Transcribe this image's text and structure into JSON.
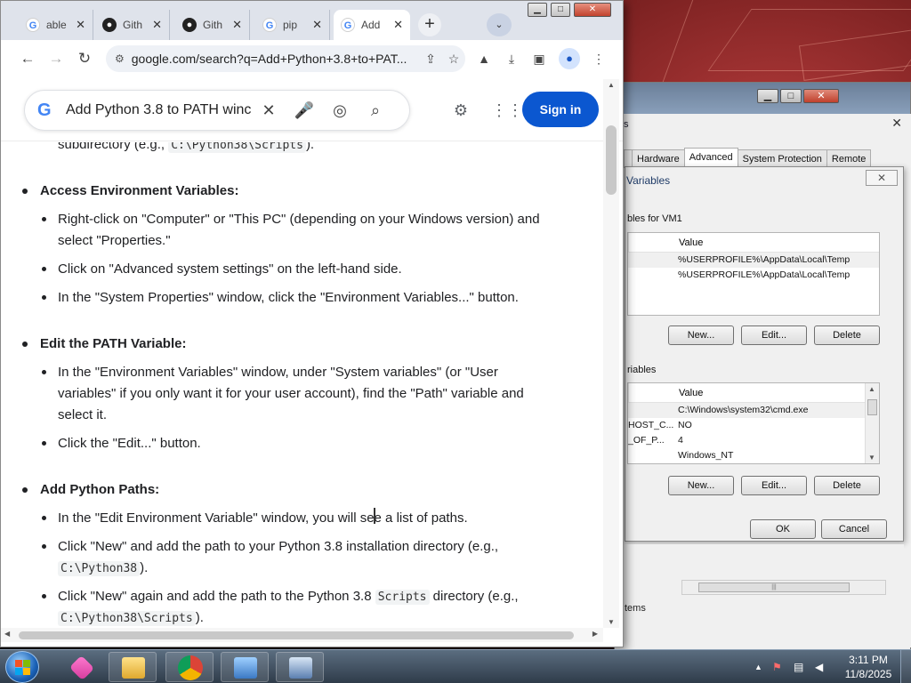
{
  "browser": {
    "tabs": [
      {
        "favicon": "google-g",
        "label": "able"
      },
      {
        "favicon": "github",
        "label": "Gith"
      },
      {
        "favicon": "github",
        "label": "Gith"
      },
      {
        "favicon": "google-g",
        "label": "pip"
      },
      {
        "favicon": "google-g",
        "label": "Add",
        "active": true
      }
    ],
    "new_tab_symbol": "+",
    "tab_search_symbol": "⌄",
    "url": "google.com/search?q=Add+Python+3.8+to+PAT...",
    "icons": [
      "back-arrow-icon",
      "forward-arrow-icon",
      "reload-icon",
      "site-info-icon",
      "share-icon",
      "bookmark-star-icon",
      "extensions-icon",
      "download-icon",
      "side-panel-icon",
      "profile-icon",
      "menu-icon"
    ]
  },
  "google": {
    "logo_letter": "G",
    "query": "Add Python 3.8 to PATH winc",
    "sign_in_label": "Sign in"
  },
  "article": {
    "top_fragment": {
      "text": "subdirectory (e.g., ",
      "code": "C:\\Python38\\Scripts",
      "suffix": ")."
    },
    "sections": [
      {
        "heading": "Access Environment Variables:",
        "bullets": [
          "Right-click on \"Computer\" or \"This PC\" (depending on your Windows version) and",
          "select \"Properties.\"",
          "Click on \"Advanced system settings\" on the left-hand side.",
          "In the \"System Properties\" window, click the \"Environment Variables...\" button."
        ]
      },
      {
        "heading": "Edit the PATH Variable:",
        "bullets": [
          "In the \"Environment Variables\" window, under \"System variables\" (or \"User",
          "variables\" if you only want it for your user account), find the \"Path\" variable and",
          "select it.",
          "Click the \"Edit...\" button."
        ]
      },
      {
        "heading": "Add Python Paths:",
        "bullets": [
          "In the \"Edit Environment Variable\" window, you will see a list of paths.",
          "Click \"New\" and add the path to your Python 3.8 installation directory (e.g.,",
          "Click \"New\" again and add the path to the Python 3.8 ",
          " directory (e.g.,"
        ],
        "codes": [
          "C:\\Python38",
          "Scripts",
          "C:\\Python38\\Scripts"
        ],
        "suffixes": [
          ")."
        ]
      }
    ]
  },
  "system_properties": {
    "title_fragment": "s",
    "tabs": [
      "Hardware",
      "Advanced",
      "System Protection",
      "Remote"
    ],
    "active_tab": "Advanced",
    "bottom_fragment": "tems",
    "scroll_grip": "|||"
  },
  "env_vars": {
    "title": "Variables",
    "close_symbol": "✕",
    "user_group_label": "bles for VM1",
    "system_group_label": "riables",
    "value_header": "Value",
    "user_rows": [
      {
        "name": "",
        "value": "%USERPROFILE%\\AppData\\Local\\Temp"
      },
      {
        "name": "",
        "value": "%USERPROFILE%\\AppData\\Local\\Temp"
      }
    ],
    "system_rows": [
      {
        "name": "",
        "value": "C:\\Windows\\system32\\cmd.exe"
      },
      {
        "name": "HOST_C...",
        "value": "NO"
      },
      {
        "name": "_OF_P...",
        "value": "4"
      },
      {
        "name": "",
        "value": "Windows_NT"
      }
    ],
    "buttons": {
      "new": "New...",
      "edit": "Edit...",
      "delete": "Delete",
      "ok": "OK",
      "cancel": "Cancel"
    }
  },
  "taskbar": {
    "apps": [
      "start-orb",
      "app-pink-icon",
      "file-explorer-icon",
      "chrome-icon",
      "control-panel-icon",
      "remote-desktop-icon"
    ],
    "time": "3:11 PM",
    "date": "11/8/2025",
    "tray_up_symbol": "▲"
  }
}
